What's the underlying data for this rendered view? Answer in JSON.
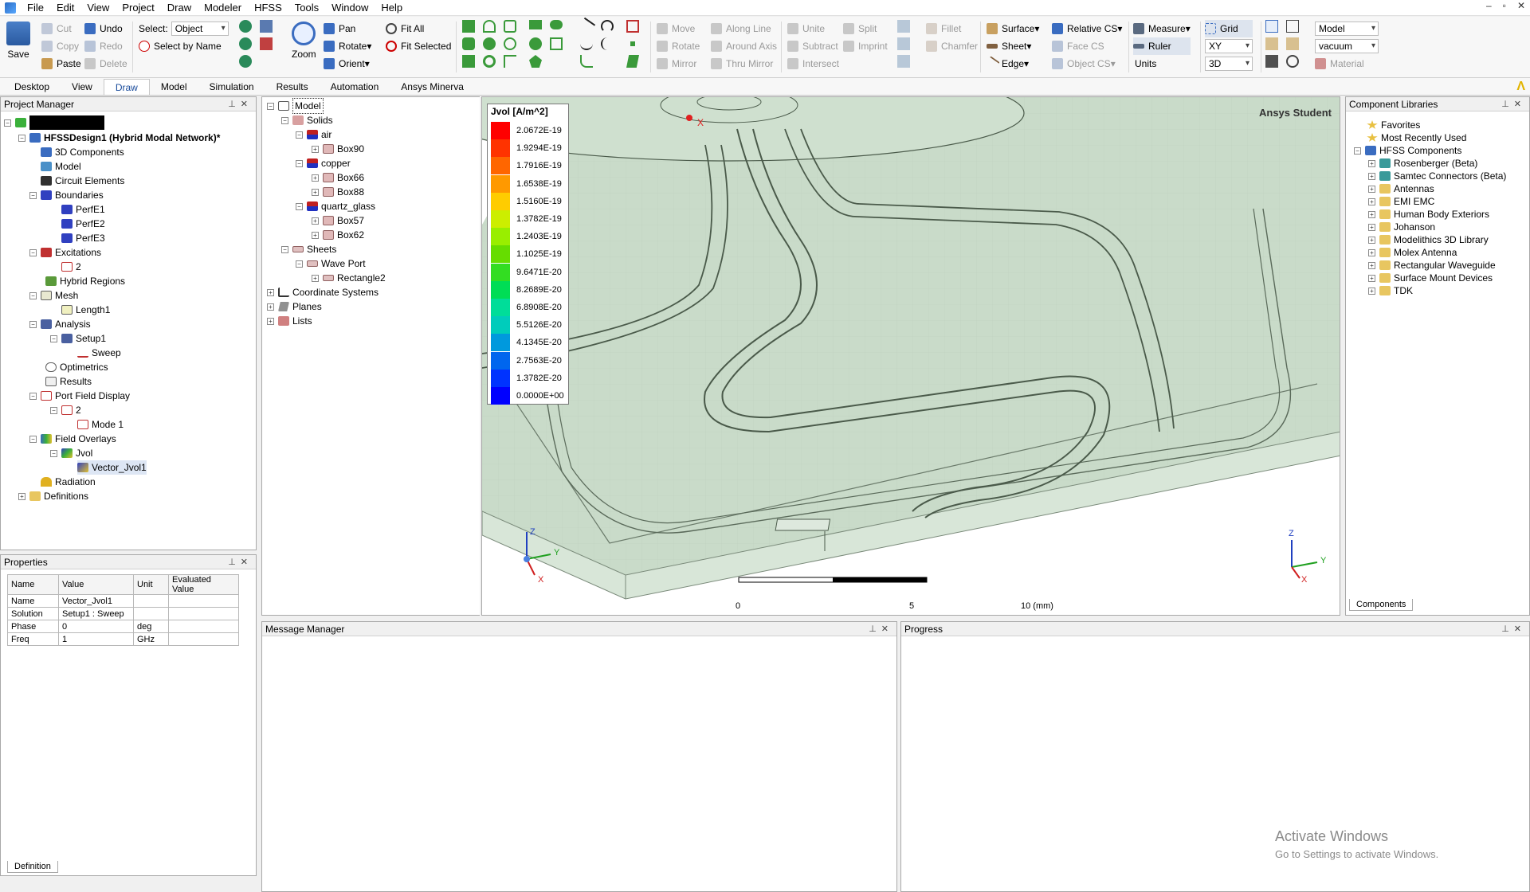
{
  "menu": [
    "File",
    "Edit",
    "View",
    "Project",
    "Draw",
    "Modeler",
    "HFSS",
    "Tools",
    "Window",
    "Help"
  ],
  "window_controls": [
    "–",
    "▫",
    "✕"
  ],
  "ribbon": {
    "save": "Save",
    "clipboard": {
      "cut": "Cut",
      "copy": "Copy",
      "paste": "Paste",
      "undo": "Undo",
      "redo": "Redo",
      "delete": "Delete"
    },
    "select_label": "Select:",
    "select_value": "Object",
    "select_by_name": "Select by Name",
    "zoom": "Zoom",
    "pan": "Pan",
    "rotate": "Rotate",
    "orient": "Orient",
    "fit_all": "Fit All",
    "fit_selected": "Fit Selected",
    "transform": {
      "move": "Move",
      "rotate": "Rotate",
      "mirror": "Mirror",
      "along_line": "Along Line",
      "around_axis": "Around Axis",
      "thru_mirror": "Thru Mirror"
    },
    "boolean": {
      "unite": "Unite",
      "subtract": "Subtract",
      "intersect": "Intersect",
      "split": "Split",
      "imprint": "Imprint"
    },
    "fillet": "Fillet",
    "chamfer": "Chamfer",
    "surface": "Surface",
    "sheet": "Sheet",
    "edge": "Edge",
    "relative_cs": "Relative CS",
    "face_cs": "Face CS",
    "object_cs": "Object CS",
    "measure": "Measure",
    "ruler": "Ruler",
    "units": "Units",
    "grid": "Grid",
    "plane_value": "XY",
    "dim_value": "3D",
    "model_value": "Model",
    "material_value": "vacuum",
    "material": "Material"
  },
  "tabs": [
    "Desktop",
    "View",
    "Draw",
    "Model",
    "Simulation",
    "Results",
    "Automation",
    "Ansys Minerva"
  ],
  "project_manager": {
    "title": "Project Manager",
    "design": "HFSSDesign1 (Hybrid Modal Network)*",
    "items": [
      "3D Components",
      "Model",
      "Circuit Elements",
      "Boundaries",
      "PerfE1",
      "PerfE2",
      "PerfE3",
      "Excitations",
      "2",
      "Hybrid Regions",
      "Mesh",
      "Length1",
      "Analysis",
      "Setup1",
      "Sweep",
      "Optimetrics",
      "Results",
      "Port Field Display",
      "2",
      "Mode 1",
      "Field Overlays",
      "Jvol",
      "Vector_Jvol1",
      "Radiation",
      "Definitions"
    ]
  },
  "model_tree": {
    "items": [
      "Model",
      "Solids",
      "air",
      "Box90",
      "copper",
      "Box66",
      "Box88",
      "quartz_glass",
      "Box57",
      "Box62",
      "Sheets",
      "Wave Port",
      "Rectangle2",
      "Coordinate Systems",
      "Planes",
      "Lists"
    ]
  },
  "properties": {
    "title": "Properties",
    "headers": [
      "Name",
      "Value",
      "Unit",
      "Evaluated Value"
    ],
    "rows": [
      [
        "Name",
        "Vector_Jvol1",
        "",
        ""
      ],
      [
        "Solution",
        "Setup1 : Sweep",
        "",
        ""
      ],
      [
        "Phase",
        "0",
        "deg",
        ""
      ],
      [
        "Freq",
        "1",
        "GHz",
        ""
      ]
    ],
    "tab": "Definition"
  },
  "legend": {
    "title": "Jvol [A/m^2]",
    "values": [
      "2.0672E-19",
      "1.9294E-19",
      "1.7916E-19",
      "1.6538E-19",
      "1.5160E-19",
      "1.3782E-19",
      "1.2403E-19",
      "1.1025E-19",
      "9.6471E-20",
      "8.2689E-20",
      "6.8908E-20",
      "5.5126E-20",
      "4.1345E-20",
      "2.7563E-20",
      "1.3782E-20",
      "0.0000E+00"
    ],
    "colors": [
      "#ff0000",
      "#ff3300",
      "#ff6600",
      "#ff9900",
      "#ffcc00",
      "#ccee00",
      "#99ee00",
      "#66dd00",
      "#33dd22",
      "#00dd55",
      "#00dd99",
      "#00ccbb",
      "#0099dd",
      "#0066ee",
      "#0033ff",
      "#0000ff"
    ]
  },
  "viewport": {
    "watermark": "Ansys Student",
    "scale": [
      "0",
      "5",
      "10 (mm)"
    ],
    "axes": [
      "Z",
      "Y",
      "X"
    ]
  },
  "component_libraries": {
    "title": "Component Libraries",
    "items": [
      "Favorites",
      "Most Recently Used",
      "HFSS Components",
      "Rosenberger (Beta)",
      "Samtec Connectors (Beta)",
      "Antennas",
      "EMI EMC",
      "Human Body Exteriors",
      "Johanson",
      "Modelithics 3D Library",
      "Molex Antenna",
      "Rectangular Waveguide",
      "Surface Mount Devices",
      "TDK"
    ],
    "tab": "Components"
  },
  "message_manager": {
    "title": "Message Manager"
  },
  "progress": {
    "title": "Progress"
  },
  "activation": {
    "line1": "Activate Windows",
    "line2": "Go to Settings to activate Windows."
  }
}
